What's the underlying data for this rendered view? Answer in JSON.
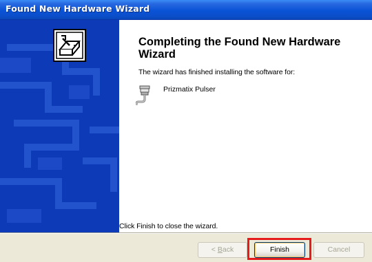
{
  "window": {
    "title": "Found New Hardware Wizard"
  },
  "content": {
    "heading": "Completing the Found New Hardware Wizard",
    "finished_text": "The wizard has finished installing the software for:",
    "device_name": "Prizmatix Pulser",
    "device_icon": "serial-cable-icon",
    "close_text": "Click Finish to close the wizard."
  },
  "buttons": {
    "back": {
      "prefix": "< ",
      "accel": "B",
      "rest": "ack",
      "enabled": false
    },
    "finish": {
      "label": "Finish",
      "enabled": true
    },
    "cancel": {
      "label": "Cancel",
      "enabled": false
    }
  },
  "side_panel": {
    "icon": "wizard-hardware-icon"
  },
  "colors": {
    "title_bar": "#0a53d6",
    "side_panel": "#0d3ab6",
    "button_bar": "#ece9d8",
    "highlight": "#e51a1a"
  }
}
